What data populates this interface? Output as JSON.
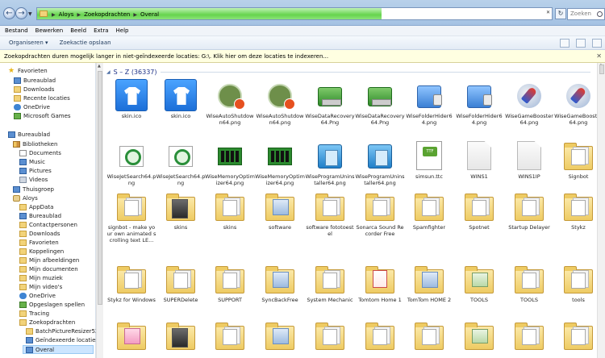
{
  "addressbar": {
    "crumbs": [
      "Aloys",
      "Zoekopdrachten",
      "Overal"
    ],
    "progress_fraction": 0.67
  },
  "search": {
    "placeholder": "Zoeken"
  },
  "menu": [
    "Bestand",
    "Bewerken",
    "Beeld",
    "Extra",
    "Help"
  ],
  "toolbar": {
    "organize": "Organiseren",
    "save_search": "Zoekactie opslaan"
  },
  "infobar": {
    "text": "Zoekopdrachten duren mogelijk langer in niet-geïndexeerde locaties: G:\\. Klik hier om deze locaties te indexeren..."
  },
  "nav": {
    "favorites": "Favorieten",
    "favorites_items": [
      "Bureaublad",
      "Downloads",
      "Recente locaties",
      "OneDrive",
      "Microsoft Games"
    ],
    "desktop": "Bureaublad",
    "libraries": "Bibliotheken",
    "libraries_items": [
      "Documents",
      "Music",
      "Pictures",
      "Videos"
    ],
    "homegroup": "Thuisgroep",
    "user": "Aloys",
    "user_items": [
      "AppData",
      "Bureaublad",
      "Contactpersonen",
      "Downloads",
      "Favorieten",
      "Koppelingen",
      "Mijn afbeeldingen",
      "Mijn documenten",
      "Mijn muziek",
      "Mijn video's",
      "OneDrive",
      "Opgeslagen spellen",
      "Tracing",
      "Zoekopdrachten"
    ],
    "search_items": [
      "BatchPictureResizer52.zip",
      "Geïndexeerde locaties",
      "Overal"
    ]
  },
  "group": {
    "label": "S – Z (36337)"
  },
  "files": [
    {
      "name": "skin.ico",
      "icon": "tshirt-icon"
    },
    {
      "name": "skin.ico",
      "icon": "tshirt-icon"
    },
    {
      "name": "WiseAutoShutdown64.png",
      "icon": "shutdown-icon"
    },
    {
      "name": "WiseAutoShutdown64.png",
      "icon": "shutdown-icon"
    },
    {
      "name": "WiseDataRecovery64.Png",
      "icon": "recover-icon"
    },
    {
      "name": "WiseDataRecovery64.Png",
      "icon": "recover-icon"
    },
    {
      "name": "WiseFolderHider64.png",
      "icon": "lock-folder-icon"
    },
    {
      "name": "WiseFolderHider64.png",
      "icon": "lock-folder-icon"
    },
    {
      "name": "WiseGameBooster64.png",
      "icon": "rocket-icon"
    },
    {
      "name": "WiseGameBooster64.png",
      "icon": "rocket-icon"
    },
    {
      "name": "WiseJetSearch64.png",
      "icon": "search-icon"
    },
    {
      "name": "WiseJetSearch64.png",
      "icon": "search-icon"
    },
    {
      "name": "WiseMemoryOptimizer64.png",
      "icon": "memory-icon"
    },
    {
      "name": "WiseMemoryOptimizer64.png",
      "icon": "memory-icon"
    },
    {
      "name": "WiseProgramUninstaller64.png",
      "icon": "uninstall-icon"
    },
    {
      "name": "WiseProgramUninstaller64.png",
      "icon": "uninstall-icon"
    },
    {
      "name": "simsun.ttc",
      "icon": "font-icon"
    },
    {
      "name": "WINS1",
      "icon": "file-icon"
    },
    {
      "name": "WINS1IP",
      "icon": "file-icon"
    },
    {
      "name": "Signbot",
      "icon": "folder-icon"
    },
    {
      "name": "signbot - make your own animated scrolling text LE...",
      "icon": "folder-icon"
    },
    {
      "name": "skins",
      "icon": "folder-icon"
    },
    {
      "name": "skins",
      "icon": "folder-icon"
    },
    {
      "name": "software",
      "icon": "folder-icon"
    },
    {
      "name": "software fototoestel",
      "icon": "folder-icon"
    },
    {
      "name": "Sonarca Sound Recorder Free",
      "icon": "folder-icon"
    },
    {
      "name": "Spamfighter",
      "icon": "folder-icon"
    },
    {
      "name": "Spotnet",
      "icon": "folder-icon"
    },
    {
      "name": "Startup Delayer",
      "icon": "folder-icon"
    },
    {
      "name": "Stykz",
      "icon": "folder-icon"
    },
    {
      "name": "Stykz for Windows",
      "icon": "folder-icon"
    },
    {
      "name": "SUPERDelete",
      "icon": "folder-icon"
    },
    {
      "name": "SUPPORT",
      "icon": "folder-icon"
    },
    {
      "name": "SyncBackFree",
      "icon": "folder-icon"
    },
    {
      "name": "System Mechanic",
      "icon": "folder-icon"
    },
    {
      "name": "Tomtom Home 1",
      "icon": "folder-icon"
    },
    {
      "name": "TomTom HOME 2",
      "icon": "folder-icon"
    },
    {
      "name": "TOOLS",
      "icon": "folder-icon"
    },
    {
      "name": "TOOLS",
      "icon": "folder-icon"
    },
    {
      "name": "tools",
      "icon": "folder-icon"
    },
    {
      "name": "",
      "icon": "folder-icon"
    },
    {
      "name": "",
      "icon": "folder-icon"
    },
    {
      "name": "",
      "icon": "folder-icon"
    },
    {
      "name": "",
      "icon": "folder-icon"
    },
    {
      "name": "",
      "icon": "folder-icon"
    },
    {
      "name": "",
      "icon": "folder-icon"
    },
    {
      "name": "",
      "icon": "folder-icon"
    },
    {
      "name": "",
      "icon": "folder-icon"
    },
    {
      "name": "",
      "icon": "folder-icon"
    },
    {
      "name": "",
      "icon": "folder-icon"
    }
  ]
}
